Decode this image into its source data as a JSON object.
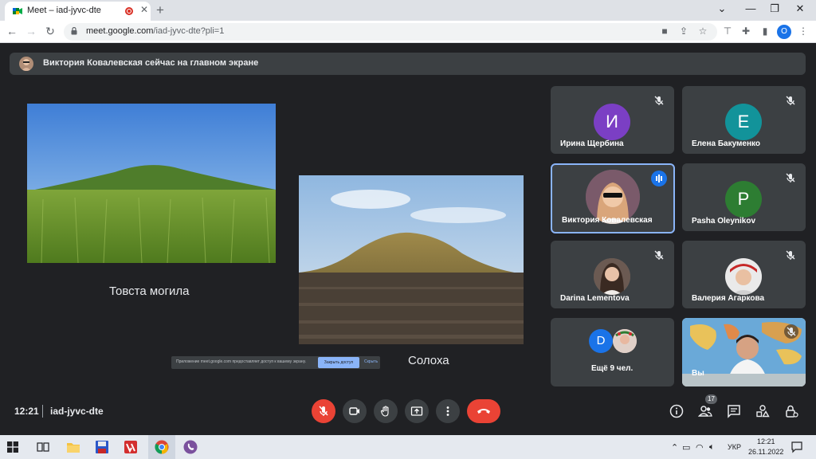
{
  "browser": {
    "tab_title": "Meet – iad-jyvc-dte",
    "tab_close": "✕",
    "new_tab": "+",
    "url_host": "meet.google.com",
    "url_path": "/iad-jyvc-dte?pli=1",
    "profile_initial": "O"
  },
  "meet": {
    "presenter_banner": "Виктория Ковалевская сейчас на главном экране",
    "slide": {
      "caption_1": "Товста могила",
      "caption_2": "Солоха"
    },
    "share_notice": {
      "message": "Приложение meet.google.com предоставляет доступ к вашему экрану.",
      "stop_label": "Закрыть доступ",
      "hide_label": "Скрыть"
    },
    "participants": [
      {
        "name": "Ирина Щербина",
        "initial": "И",
        "color": "#7b3fc4",
        "muted": true
      },
      {
        "name": "Елена Бакуменко",
        "initial": "Е",
        "color": "#12939a",
        "muted": true
      },
      {
        "name": "Виктория Ковалевская",
        "initial": "",
        "color": "#5f6368",
        "speaking": true
      },
      {
        "name": "Pasha Oleynikov",
        "initial": "P",
        "color": "#2d7d32",
        "muted": true
      },
      {
        "name": "Darina Lementova",
        "initial": "",
        "color": "#5f6368",
        "muted": true
      },
      {
        "name": "Валерия Агаркова",
        "initial": "",
        "color": "#5f6368",
        "muted": true
      },
      {
        "name": "Ещё 9 чел.",
        "initial": "D",
        "color": "#1a73e8"
      },
      {
        "name": "Вы",
        "initial": "",
        "color": "#5f6368",
        "muted": true
      }
    ],
    "bottom": {
      "time": "12:21",
      "meeting_code": "iad-jyvc-dte",
      "people_count": "17"
    },
    "colors": {
      "background": "#202124",
      "tile": "#3c4043",
      "danger": "#ea4335",
      "accent": "#8ab4f8"
    }
  },
  "taskbar": {
    "language": "УКР",
    "time": "12:21",
    "date": "26.11.2022"
  }
}
